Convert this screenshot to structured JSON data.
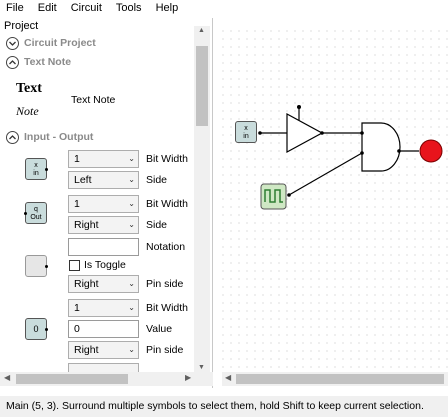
{
  "menu": [
    "File",
    "Edit",
    "Circuit",
    "Tools",
    "Help"
  ],
  "project_label": "Project",
  "tree": {
    "circuit_project": "Circuit Project",
    "text_note": "Text Note",
    "input_output": "Input - Output"
  },
  "text_note_section": {
    "text_sample": "Text",
    "note_sample": "Note",
    "label": "Text Note"
  },
  "properties": {
    "bit_width_1_value": "1",
    "bit_width_1_label": "Bit Width",
    "side_1_value": "Left",
    "side_1_label": "Side",
    "bit_width_2_value": "1",
    "bit_width_2_label": "Bit Width",
    "side_2_value": "Right",
    "side_2_label": "Side",
    "notation_value": "",
    "notation_label": "Notation",
    "is_toggle_label": "Is Toggle",
    "pin_side_1_value": "Right",
    "pin_side_1_label": "Pin side",
    "bit_width_3_value": "1",
    "bit_width_3_label": "Bit Width",
    "value_value": "0",
    "value_label": "Value",
    "pin_side_2_value": "Right",
    "pin_side_2_label": "Pin side"
  },
  "symbols": {
    "input_x": "x",
    "input_in": "in",
    "output_q": "q",
    "output_out": "Out",
    "constant_value": "0",
    "canvas_input_x": "x",
    "canvas_input_in": "in"
  },
  "status_text": "Main (5, 3). Surround multiple symbols to select them, hold Shift to keep current selection.",
  "colors": {
    "symbol_fill": "#c9dcdc",
    "led_red": "#e8141c",
    "clock_fill": "#cfe8c4"
  }
}
